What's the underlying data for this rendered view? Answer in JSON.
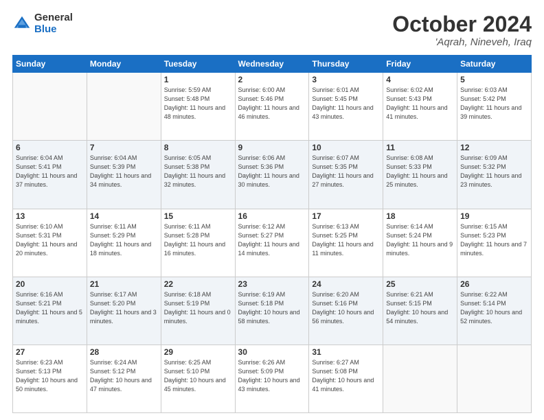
{
  "logo": {
    "general": "General",
    "blue": "Blue"
  },
  "header": {
    "month": "October 2024",
    "location": "'Aqrah, Nineveh, Iraq"
  },
  "weekdays": [
    "Sunday",
    "Monday",
    "Tuesday",
    "Wednesday",
    "Thursday",
    "Friday",
    "Saturday"
  ],
  "weeks": [
    [
      {
        "day": "",
        "info": ""
      },
      {
        "day": "",
        "info": ""
      },
      {
        "day": "1",
        "info": "Sunrise: 5:59 AM\nSunset: 5:48 PM\nDaylight: 11 hours and 48 minutes."
      },
      {
        "day": "2",
        "info": "Sunrise: 6:00 AM\nSunset: 5:46 PM\nDaylight: 11 hours and 46 minutes."
      },
      {
        "day": "3",
        "info": "Sunrise: 6:01 AM\nSunset: 5:45 PM\nDaylight: 11 hours and 43 minutes."
      },
      {
        "day": "4",
        "info": "Sunrise: 6:02 AM\nSunset: 5:43 PM\nDaylight: 11 hours and 41 minutes."
      },
      {
        "day": "5",
        "info": "Sunrise: 6:03 AM\nSunset: 5:42 PM\nDaylight: 11 hours and 39 minutes."
      }
    ],
    [
      {
        "day": "6",
        "info": "Sunrise: 6:04 AM\nSunset: 5:41 PM\nDaylight: 11 hours and 37 minutes."
      },
      {
        "day": "7",
        "info": "Sunrise: 6:04 AM\nSunset: 5:39 PM\nDaylight: 11 hours and 34 minutes."
      },
      {
        "day": "8",
        "info": "Sunrise: 6:05 AM\nSunset: 5:38 PM\nDaylight: 11 hours and 32 minutes."
      },
      {
        "day": "9",
        "info": "Sunrise: 6:06 AM\nSunset: 5:36 PM\nDaylight: 11 hours and 30 minutes."
      },
      {
        "day": "10",
        "info": "Sunrise: 6:07 AM\nSunset: 5:35 PM\nDaylight: 11 hours and 27 minutes."
      },
      {
        "day": "11",
        "info": "Sunrise: 6:08 AM\nSunset: 5:33 PM\nDaylight: 11 hours and 25 minutes."
      },
      {
        "day": "12",
        "info": "Sunrise: 6:09 AM\nSunset: 5:32 PM\nDaylight: 11 hours and 23 minutes."
      }
    ],
    [
      {
        "day": "13",
        "info": "Sunrise: 6:10 AM\nSunset: 5:31 PM\nDaylight: 11 hours and 20 minutes."
      },
      {
        "day": "14",
        "info": "Sunrise: 6:11 AM\nSunset: 5:29 PM\nDaylight: 11 hours and 18 minutes."
      },
      {
        "day": "15",
        "info": "Sunrise: 6:11 AM\nSunset: 5:28 PM\nDaylight: 11 hours and 16 minutes."
      },
      {
        "day": "16",
        "info": "Sunrise: 6:12 AM\nSunset: 5:27 PM\nDaylight: 11 hours and 14 minutes."
      },
      {
        "day": "17",
        "info": "Sunrise: 6:13 AM\nSunset: 5:25 PM\nDaylight: 11 hours and 11 minutes."
      },
      {
        "day": "18",
        "info": "Sunrise: 6:14 AM\nSunset: 5:24 PM\nDaylight: 11 hours and 9 minutes."
      },
      {
        "day": "19",
        "info": "Sunrise: 6:15 AM\nSunset: 5:23 PM\nDaylight: 11 hours and 7 minutes."
      }
    ],
    [
      {
        "day": "20",
        "info": "Sunrise: 6:16 AM\nSunset: 5:21 PM\nDaylight: 11 hours and 5 minutes."
      },
      {
        "day": "21",
        "info": "Sunrise: 6:17 AM\nSunset: 5:20 PM\nDaylight: 11 hours and 3 minutes."
      },
      {
        "day": "22",
        "info": "Sunrise: 6:18 AM\nSunset: 5:19 PM\nDaylight: 11 hours and 0 minutes."
      },
      {
        "day": "23",
        "info": "Sunrise: 6:19 AM\nSunset: 5:18 PM\nDaylight: 10 hours and 58 minutes."
      },
      {
        "day": "24",
        "info": "Sunrise: 6:20 AM\nSunset: 5:16 PM\nDaylight: 10 hours and 56 minutes."
      },
      {
        "day": "25",
        "info": "Sunrise: 6:21 AM\nSunset: 5:15 PM\nDaylight: 10 hours and 54 minutes."
      },
      {
        "day": "26",
        "info": "Sunrise: 6:22 AM\nSunset: 5:14 PM\nDaylight: 10 hours and 52 minutes."
      }
    ],
    [
      {
        "day": "27",
        "info": "Sunrise: 6:23 AM\nSunset: 5:13 PM\nDaylight: 10 hours and 50 minutes."
      },
      {
        "day": "28",
        "info": "Sunrise: 6:24 AM\nSunset: 5:12 PM\nDaylight: 10 hours and 47 minutes."
      },
      {
        "day": "29",
        "info": "Sunrise: 6:25 AM\nSunset: 5:10 PM\nDaylight: 10 hours and 45 minutes."
      },
      {
        "day": "30",
        "info": "Sunrise: 6:26 AM\nSunset: 5:09 PM\nDaylight: 10 hours and 43 minutes."
      },
      {
        "day": "31",
        "info": "Sunrise: 6:27 AM\nSunset: 5:08 PM\nDaylight: 10 hours and 41 minutes."
      },
      {
        "day": "",
        "info": ""
      },
      {
        "day": "",
        "info": ""
      }
    ]
  ]
}
